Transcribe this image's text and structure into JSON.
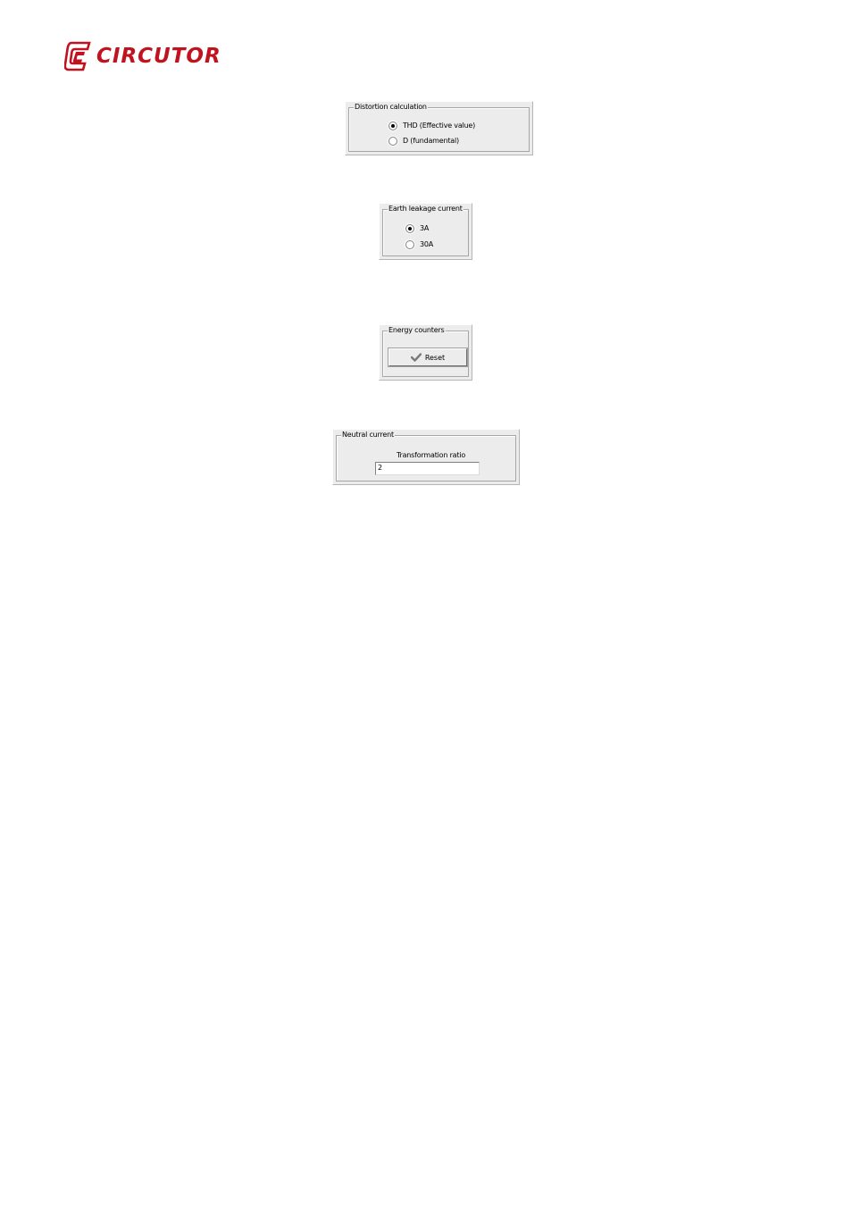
{
  "brand": {
    "name": "CIRCUTOR",
    "color": "#c1121f",
    "logo_icon": "circutor-logo-icon"
  },
  "distortion_calculation": {
    "title": "Distortion calculation",
    "options": [
      {
        "label": "THD (Effective value)",
        "checked": true
      },
      {
        "label": "D (fundamental)",
        "checked": false
      }
    ]
  },
  "earth_leakage_current": {
    "title": "Earth leakage current",
    "options": [
      {
        "label": "3A",
        "checked": true
      },
      {
        "label": "30A",
        "checked": false
      }
    ]
  },
  "energy_counters": {
    "title": "Energy counters",
    "reset_label": "Reset",
    "reset_icon": "checkmark-icon"
  },
  "neutral_current": {
    "title": "Neutral current",
    "ratio_label": "Transformation ratio",
    "ratio_value": "2"
  }
}
